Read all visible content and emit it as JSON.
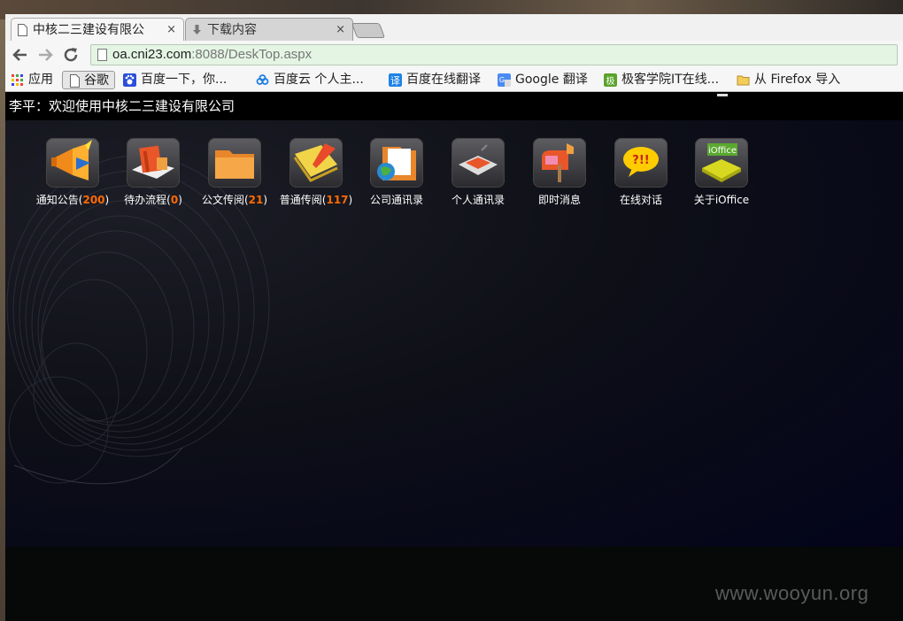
{
  "browser": {
    "tabs": [
      {
        "title": "中核二三建设有限公",
        "close": "×",
        "active": true
      },
      {
        "title": "下载内容",
        "close": "×",
        "active": false
      }
    ],
    "url_host": "oa.cni23.com",
    "url_rest": ":8088/DeskTop.aspx",
    "bookmarks": [
      {
        "label": "应用",
        "icon": "apps-grid-icon"
      },
      {
        "label": "谷歌",
        "icon": "page-icon"
      },
      {
        "label": "百度一下，你...",
        "icon": "baidu-paw-icon"
      },
      {
        "label": "百度云 个人主...",
        "icon": "baidu-cloud-icon"
      },
      {
        "label": "百度在线翻译",
        "icon": "translate-icon"
      },
      {
        "label": "Google 翻译",
        "icon": "google-translate-icon"
      },
      {
        "label": "极客学院IT在线...",
        "icon": "jikexueyuan-icon"
      },
      {
        "label": "从 Firefox 导入",
        "icon": "folder-icon"
      }
    ]
  },
  "page": {
    "welcome": "李平：欢迎使用中核二三建设有限公司",
    "icons": [
      {
        "name": "通知公告",
        "count": "200",
        "icon": "megaphone-icon"
      },
      {
        "name": "待办流程",
        "count": "0",
        "icon": "books-icon"
      },
      {
        "name": "公文传阅",
        "count": "21",
        "icon": "folder-icon"
      },
      {
        "name": "普通传阅",
        "count": "117",
        "icon": "notepad-icon"
      },
      {
        "name": "公司通讯录",
        "count": "",
        "icon": "address-book-icon"
      },
      {
        "name": "个人通讯录",
        "count": "",
        "icon": "personal-contacts-icon"
      },
      {
        "name": "即时消息",
        "count": "",
        "icon": "mailbox-icon"
      },
      {
        "name": "在线对话",
        "count": "",
        "icon": "chat-bubble-icon"
      },
      {
        "name": "关于iOffice",
        "count": "",
        "icon": "ioffice-icon"
      }
    ]
  },
  "watermark": "www.wooyun.org",
  "colors": {
    "count": "#ff6a00",
    "url_bar": "#e4f5e4",
    "page_bg": "#0b0c14"
  }
}
